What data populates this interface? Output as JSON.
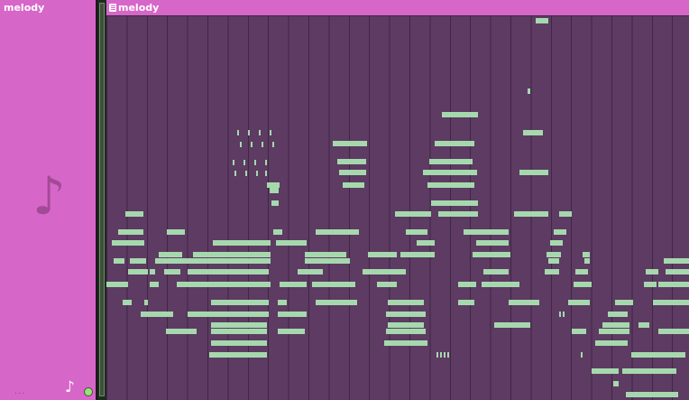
{
  "left_panel": {
    "title": "melody",
    "dots": "...",
    "note_glyph": "♪"
  },
  "editor": {
    "title": "melody",
    "title_icon": "list-icon"
  },
  "colors": {
    "panel": "#d766c9",
    "grid_bg": "#5d3b62",
    "note": "#a6d8ae",
    "led": "#9be07b"
  }
}
